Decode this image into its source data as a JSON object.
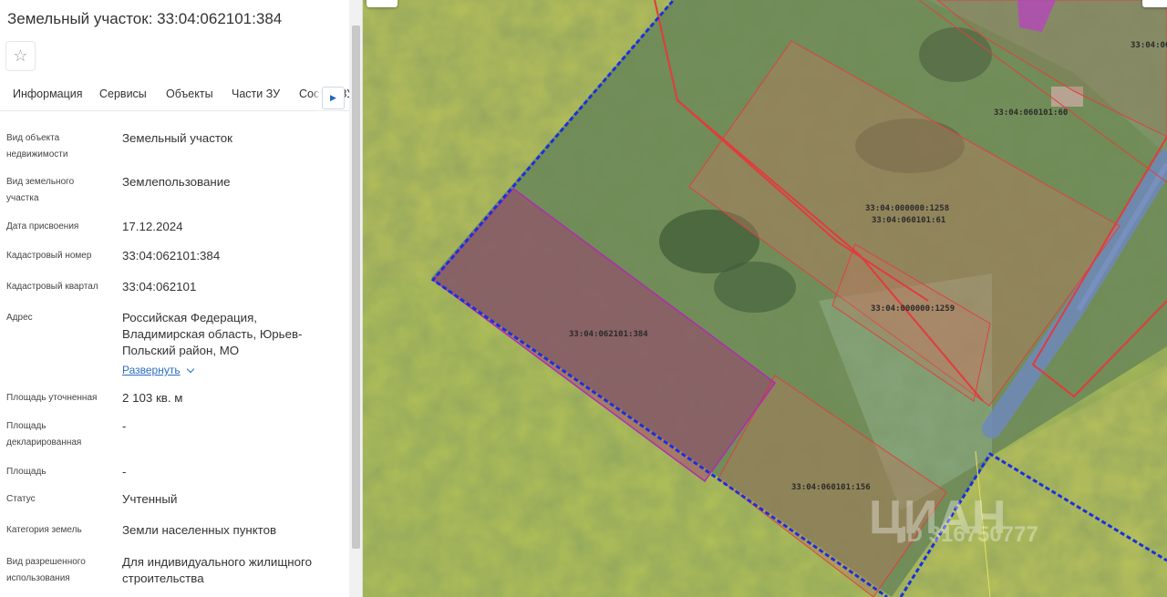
{
  "parcel": {
    "title": "Земельный участок: 33:04:062101:384"
  },
  "tabs": [
    "Информация",
    "Сервисы",
    "Объекты",
    "Части ЗУ",
    "Состав ЗУ"
  ],
  "fields": [
    {
      "label": "Вид объекта недвижимости",
      "value": "Земельный участок"
    },
    {
      "label": "Вид земельного участка",
      "value": "Землепользование"
    },
    {
      "label": "Дата присвоения",
      "value": "17.12.2024"
    },
    {
      "label": "Кадастровый номер",
      "value": "33:04:062101:384"
    },
    {
      "label": "Кадастровый квартал",
      "value": "33:04:062101"
    },
    {
      "label": "Адрес",
      "value": "Российская Федерация, Владимирская область, Юрьев-Польский район, МО"
    },
    {
      "label": "Площадь уточненная",
      "value": "2 103 кв. м"
    },
    {
      "label": "Площадь декларированная",
      "value": "-"
    },
    {
      "label": "Площадь",
      "value": "-"
    },
    {
      "label": "Статус",
      "value": "Учтенный"
    },
    {
      "label": "Категория земель",
      "value": "Земли населенных пунктов"
    },
    {
      "label": "Вид разрешенного использования",
      "value": "Для индивидуального жилищного строительства"
    }
  ],
  "address_expand": "Развернуть",
  "map": {
    "parcel_labels": [
      "33:04:062101:384",
      "33:04:060101:156",
      "33:04:000000:1258",
      "33:04:060101:61",
      "33:04:000000:1259",
      "33:04:060101:60",
      "33:04:06"
    ],
    "watermark": "ЦИАН",
    "watermark_id": "ID 316750777"
  },
  "colors": {
    "accent": "#1d67c2",
    "selected_parcel": "#b02cb0",
    "parcel_border": "#e0353a",
    "quarter_border": "#1a2fe0"
  },
  "icons": {
    "favorite": "star-outline-icon",
    "tabs_scroll": "chevron-right-icon",
    "expand": "chevron-down-icon"
  }
}
